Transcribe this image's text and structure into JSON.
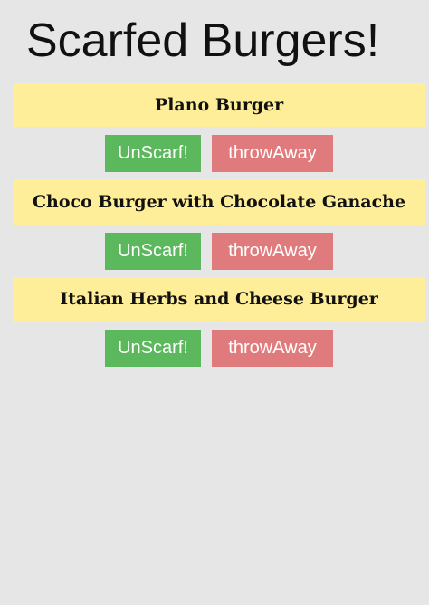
{
  "header": {
    "title": "Scarfed Burgers!"
  },
  "burgers": [
    {
      "name": "Plano Burger",
      "unscarf_label": "UnScarf!",
      "throwaway_label": "throwAway"
    },
    {
      "name": "Choco Burger with Chocolate Ganache",
      "unscarf_label": "UnScarf!",
      "throwaway_label": "throwAway"
    },
    {
      "name": "Italian Herbs and Cheese Burger",
      "unscarf_label": "UnScarf!",
      "throwaway_label": "throwAway"
    }
  ],
  "colors": {
    "background": "#e6e6e6",
    "name_bar": "#ffee99",
    "unscarf_button": "#5cb85c",
    "throwaway_button": "#e07b7d",
    "button_text": "#ffffff"
  }
}
